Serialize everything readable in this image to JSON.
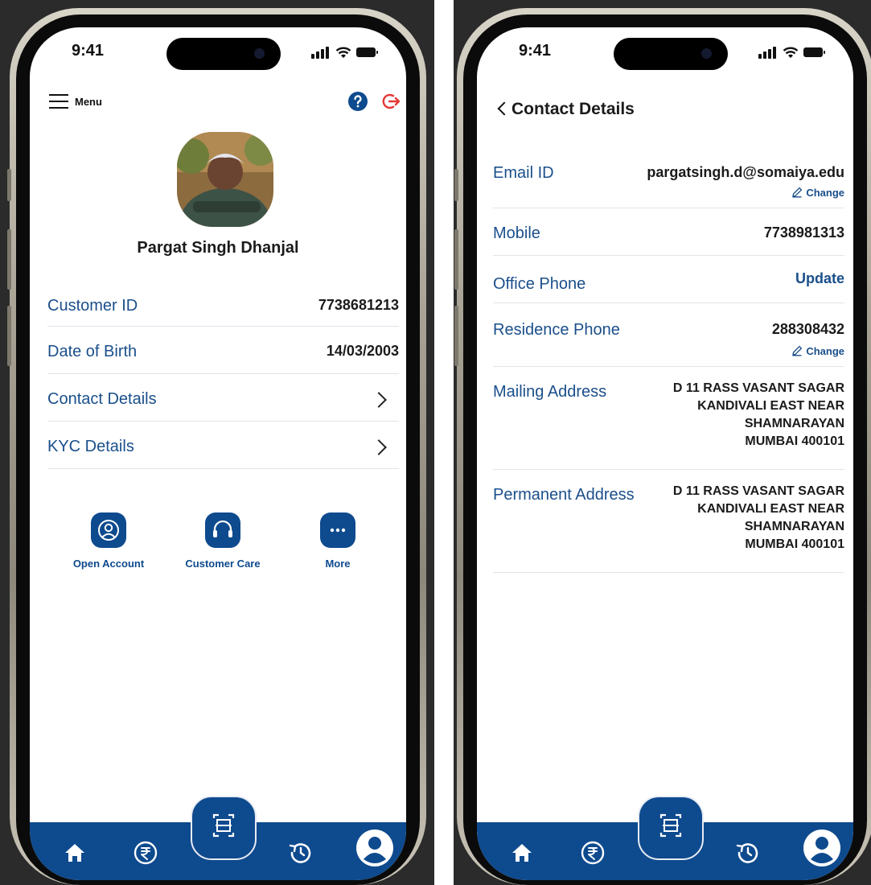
{
  "colors": {
    "primary": "#0e4a8e",
    "label": "#1a4f8b",
    "logout": "#e53935",
    "text": "#1b1b1b"
  },
  "statusbar": {
    "time": "9:41"
  },
  "profile": {
    "menu_label": "Menu",
    "help_icon": "help-circle-icon",
    "logout_icon": "logout-icon",
    "name": "Pargat Singh Dhanjal",
    "rows": [
      {
        "label": "Customer ID",
        "value": "7738681213"
      },
      {
        "label": "Date of Birth",
        "value": "14/03/2003"
      },
      {
        "label": "Contact Details",
        "value": ""
      },
      {
        "label": "KYC Details",
        "value": ""
      }
    ],
    "actions": [
      {
        "label": "Open Account",
        "icon": "user-circle-icon"
      },
      {
        "label": "Customer Care",
        "icon": "headset-icon"
      },
      {
        "label": "More",
        "icon": "more-dots-icon"
      }
    ]
  },
  "contact": {
    "title": "Contact Details",
    "change_label": "Change",
    "email": {
      "label": "Email ID",
      "value": "pargatsingh.d@somaiya.edu"
    },
    "mobile": {
      "label": "Mobile",
      "value": "7738981313"
    },
    "office": {
      "label": "Office Phone",
      "value": "Update"
    },
    "residence": {
      "label": "Residence Phone",
      "value": "288308432"
    },
    "mailing": {
      "label": "Mailing Address",
      "lines": [
        "D 11 RASS VASANT SAGAR",
        "KANDIVALI EAST NEAR",
        "SHAMNARAYAN",
        "MUMBAI 400101"
      ]
    },
    "permanent": {
      "label": "Permanent Address",
      "lines": [
        "D 11 RASS VASANT SAGAR",
        "KANDIVALI EAST NEAR",
        "SHAMNARAYAN",
        "MUMBAI 400101"
      ]
    }
  },
  "navbar": {
    "icons": [
      "home-icon",
      "rupee-icon",
      "scan-icon",
      "history-icon",
      "profile-icon"
    ]
  }
}
